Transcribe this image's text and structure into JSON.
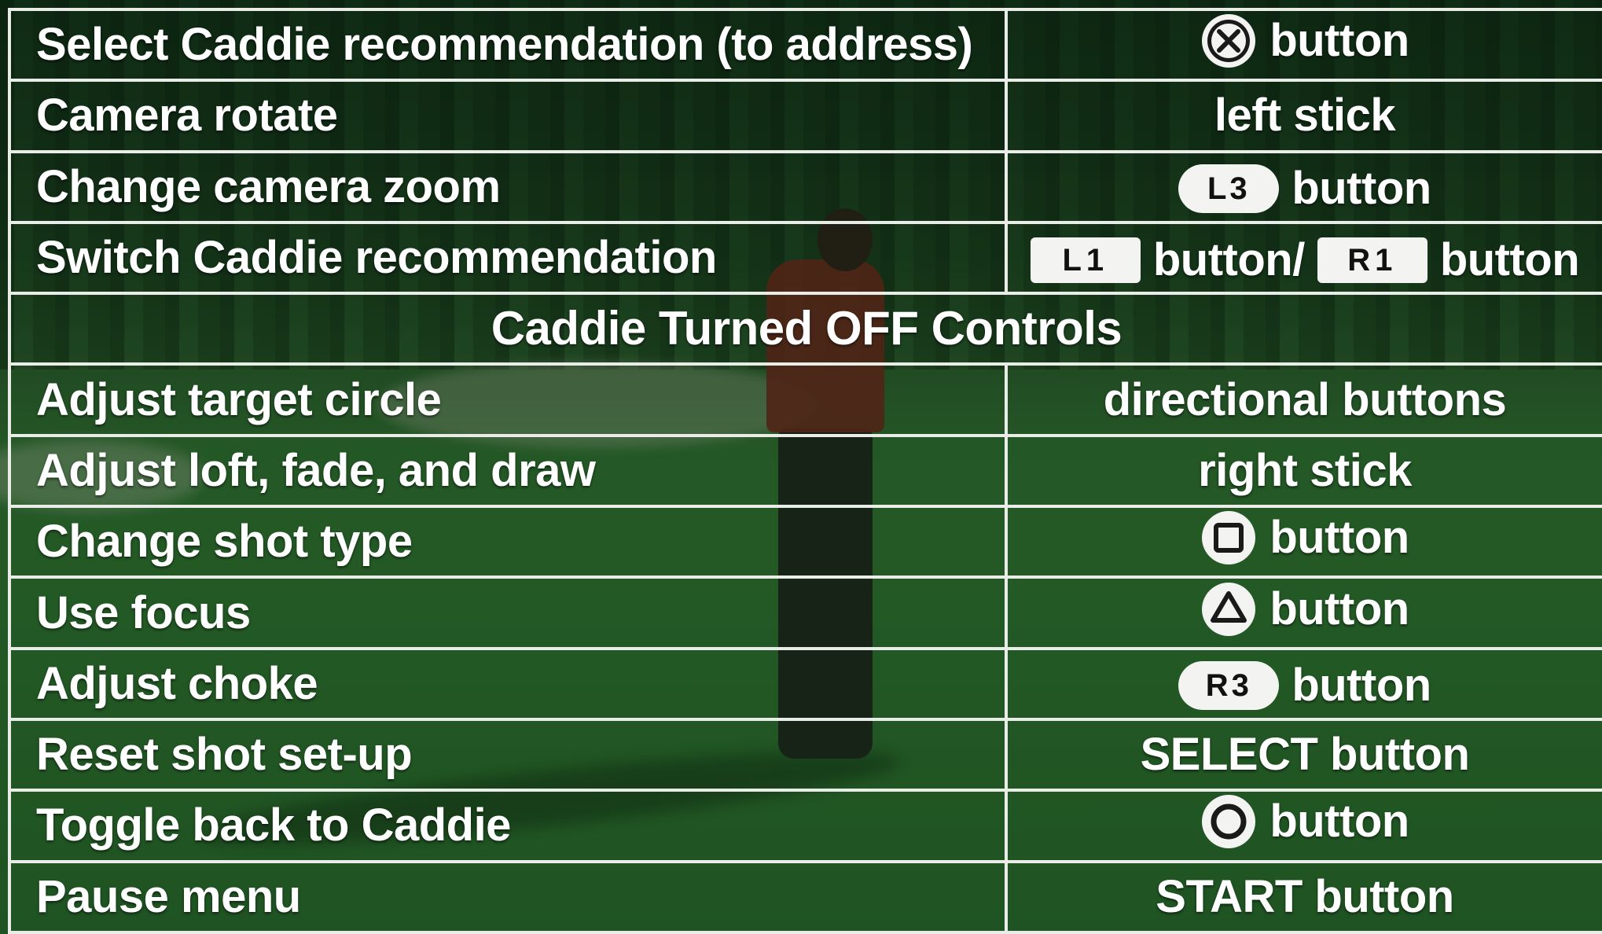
{
  "controls": {
    "rows": [
      {
        "action": "Select Caddie recommendation (to address)",
        "input_label": "button",
        "icon": "cross-button-icon"
      },
      {
        "action": "Camera rotate",
        "input_label": "left stick"
      },
      {
        "action": "Change camera zoom",
        "input_label": "button",
        "badge": "L3"
      },
      {
        "action": "Switch Caddie recommendation",
        "badge_a": "L1",
        "input_label_a": "button/",
        "badge_b": "R1",
        "input_label_b": "button"
      },
      {
        "header": "Caddie Turned OFF Controls"
      },
      {
        "action": "Adjust target circle",
        "input_label": "directional buttons"
      },
      {
        "action": "Adjust loft, fade, and draw",
        "input_label": "right stick"
      },
      {
        "action": "Change shot type",
        "input_label": "button",
        "icon": "square-button-icon"
      },
      {
        "action": "Use focus",
        "input_label": "button",
        "icon": "triangle-button-icon"
      },
      {
        "action": "Adjust choke",
        "input_label": "button",
        "badge": "R3"
      },
      {
        "action": "Reset shot set-up",
        "input_label": "SELECT button"
      },
      {
        "action": "Toggle back to Caddie",
        "input_label": "button",
        "icon": "circle-button-icon"
      },
      {
        "action": "Pause menu",
        "input_label": "START button"
      }
    ]
  },
  "colors": {
    "grid_line": "#e9ece7",
    "text": "#ffffff",
    "badge_bg": "#f3f3f1",
    "badge_text": "#111111",
    "background_green": "#2e6d2f"
  }
}
